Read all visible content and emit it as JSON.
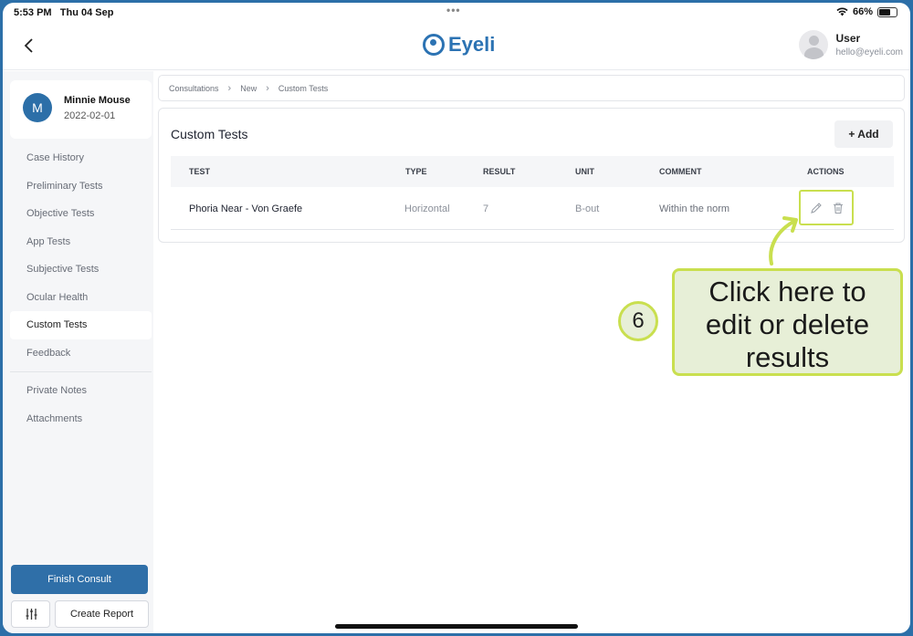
{
  "status_bar": {
    "time": "5:53 PM",
    "date": "Thu 04 Sep",
    "dots": "•••",
    "battery_text": "66%",
    "battery_level": 0.66
  },
  "header": {
    "logo_text": "Eyeli",
    "user_name": "User",
    "user_email": "hello@eyeli.com"
  },
  "patient": {
    "initial": "M",
    "name": "Minnie Mouse",
    "dob": "2022-02-01"
  },
  "sidebar": {
    "items": [
      {
        "label": "Case History"
      },
      {
        "label": "Preliminary Tests"
      },
      {
        "label": "Objective Tests"
      },
      {
        "label": "App Tests"
      },
      {
        "label": "Subjective Tests"
      },
      {
        "label": "Ocular Health"
      },
      {
        "label": "Custom Tests"
      },
      {
        "label": "Feedback"
      }
    ],
    "secondary_items": [
      {
        "label": "Private Notes"
      },
      {
        "label": "Attachments"
      }
    ],
    "finish_label": "Finish Consult",
    "report_label": "Create Report"
  },
  "breadcrumb": [
    "Consultations",
    "New",
    "Custom Tests"
  ],
  "card": {
    "title": "Custom Tests",
    "add_label": "+ Add",
    "columns": [
      "TEST",
      "TYPE",
      "RESULT",
      "UNIT",
      "COMMENT",
      "ACTIONS"
    ],
    "rows": [
      {
        "test": "Phoria Near - Von Graefe",
        "type": "Horizontal",
        "result": "7",
        "unit": "B-out",
        "comment": "Within the norm"
      }
    ]
  },
  "annotation": {
    "step": "6",
    "line1": "Click here to",
    "line2": "edit or delete",
    "line3": "results"
  },
  "colors": {
    "brand": "#2c73b3",
    "highlight": "#c9df4f",
    "callout_bg": "#e7efd7",
    "frame": "#2c6fa8"
  }
}
